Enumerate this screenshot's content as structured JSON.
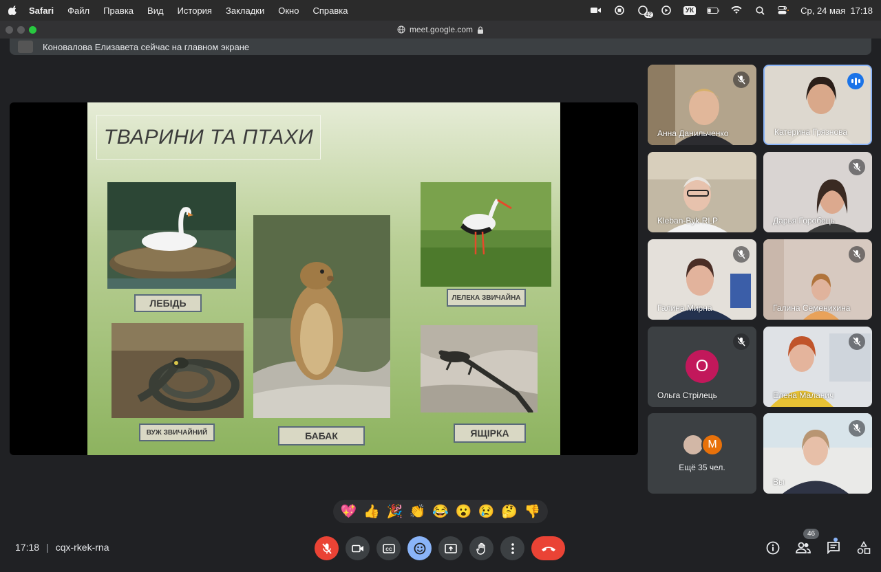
{
  "menubar": {
    "app": "Safari",
    "items": [
      "Файл",
      "Правка",
      "Вид",
      "История",
      "Закладки",
      "Окно",
      "Справка"
    ],
    "keyboard": "УК",
    "notif_count": "42",
    "datetime": "Ср, 24 мая  17:18"
  },
  "browser": {
    "url": "meet.google.com"
  },
  "banner": {
    "text": "Коновалова Елизавета сейчас на главном экране"
  },
  "slide": {
    "title": "ТВАРИНИ ТА ПТАХИ",
    "labels": {
      "swan": "ЛЕБІДЬ",
      "stork": "ЛЕЛЕКА ЗВИЧАЙНА",
      "marmot": "БАБАК",
      "snake": "ВУЖ ЗВИЧАЙНИЙ",
      "lizard": "ЯЩІРКА"
    }
  },
  "participants": [
    {
      "name": "Анна Данильченко"
    },
    {
      "name": "Катерина Грязнова"
    },
    {
      "name": "Kleban-Byk RLP"
    },
    {
      "name": "Дарья Горобець"
    },
    {
      "name": "Галина Мирна"
    },
    {
      "name": "Галина Семенихина"
    },
    {
      "name": "Ольга Стрілець",
      "initial": "О"
    },
    {
      "name": "Елена Маланич"
    },
    {
      "more": "Ещё 35 чел.",
      "initial": "M"
    },
    {
      "name": "Вы"
    }
  ],
  "reactions": [
    "💖",
    "👍",
    "🎉",
    "👏",
    "😂",
    "😮",
    "😢",
    "🤔",
    "👎"
  ],
  "footer": {
    "time": "17:18",
    "separator": "|",
    "meeting_code": "cqx-rkek-rna",
    "people_count": "46"
  }
}
